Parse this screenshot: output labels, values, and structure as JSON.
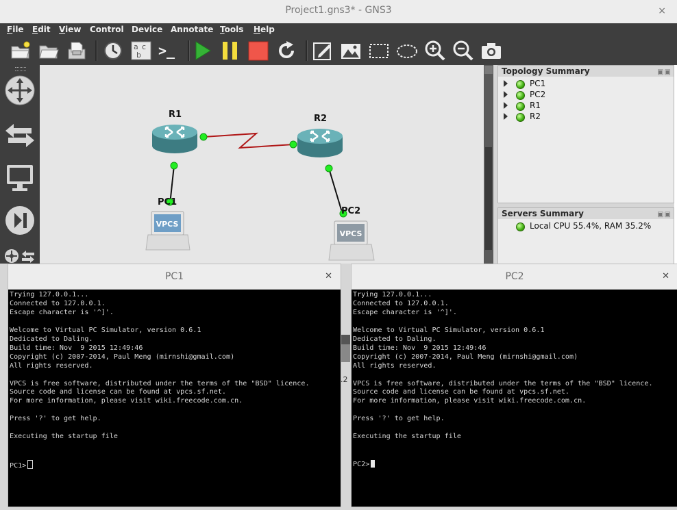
{
  "window": {
    "title": "Project1.gns3* - GNS3",
    "close_glyph": "×"
  },
  "menu": [
    "File",
    "Edit",
    "View",
    "Control",
    "Device",
    "Annotate",
    "Tools",
    "Help"
  ],
  "toolbar": {
    "icons": [
      "new-project-icon",
      "open-project-icon",
      "save-project-icon",
      "snapshot-clock-icon",
      "show-labels-icon",
      "console-icon",
      "start-icon",
      "pause-icon",
      "stop-icon",
      "reload-icon",
      "add-note-icon",
      "insert-image-icon",
      "draw-rectangle-icon",
      "draw-ellipse-icon",
      "zoom-in-icon",
      "zoom-out-icon",
      "screenshot-icon"
    ],
    "console_label": ">_"
  },
  "topology": {
    "nodes": [
      {
        "label": "R1",
        "type": "router"
      },
      {
        "label": "R2",
        "type": "router"
      },
      {
        "label": "PC1",
        "type": "vpcs"
      },
      {
        "label": "PC2",
        "type": "vpcs"
      }
    ],
    "vpcs_label": "VPCS",
    "link_color": "#b01818",
    "status_color": "#22ee22"
  },
  "topology_summary": {
    "title": "Topology Summary",
    "items": [
      "PC1",
      "PC2",
      "R1",
      "R2"
    ]
  },
  "servers_summary": {
    "title": "Servers Summary",
    "items": [
      "Local CPU 55.4%, RAM 35.2%"
    ]
  },
  "fragment_text": ".2",
  "consoles": [
    {
      "title": "PC1",
      "lines": [
        "Trying 127.0.0.1...",
        "Connected to 127.0.0.1.",
        "Escape character is '^]'.",
        "",
        "Welcome to Virtual PC Simulator, version 0.6.1",
        "Dedicated to Daling.",
        "Build time: Nov  9 2015 12:49:46",
        "Copyright (c) 2007-2014, Paul Meng (mirnshi@gmail.com)",
        "All rights reserved.",
        "",
        "VPCS is free software, distributed under the terms of the \"BSD\" licence.",
        "Source code and license can be found at vpcs.sf.net.",
        "For more information, please visit wiki.freecode.com.cn.",
        "",
        "Press '?' to get help.",
        "",
        "Executing the startup file"
      ],
      "prompt": "PC1>"
    },
    {
      "title": "PC2",
      "lines": [
        "Trying 127.0.0.1...",
        "Connected to 127.0.0.1.",
        "Escape character is '^]'.",
        "",
        "Welcome to Virtual PC Simulator, version 0.6.1",
        "Dedicated to Daling.",
        "Build time: Nov  9 2015 12:49:46",
        "Copyright (c) 2007-2014, Paul Meng (mirnshi@gmail.com)",
        "All rights reserved.",
        "",
        "VPCS is free software, distributed under the terms of the \"BSD\" licence.",
        "Source code and license can be found at vpcs.sf.net.",
        "For more information, please visit wiki.freecode.com.cn.",
        "",
        "Press '?' to get help.",
        "",
        "Executing the startup file"
      ],
      "prompt": "PC2>"
    }
  ]
}
